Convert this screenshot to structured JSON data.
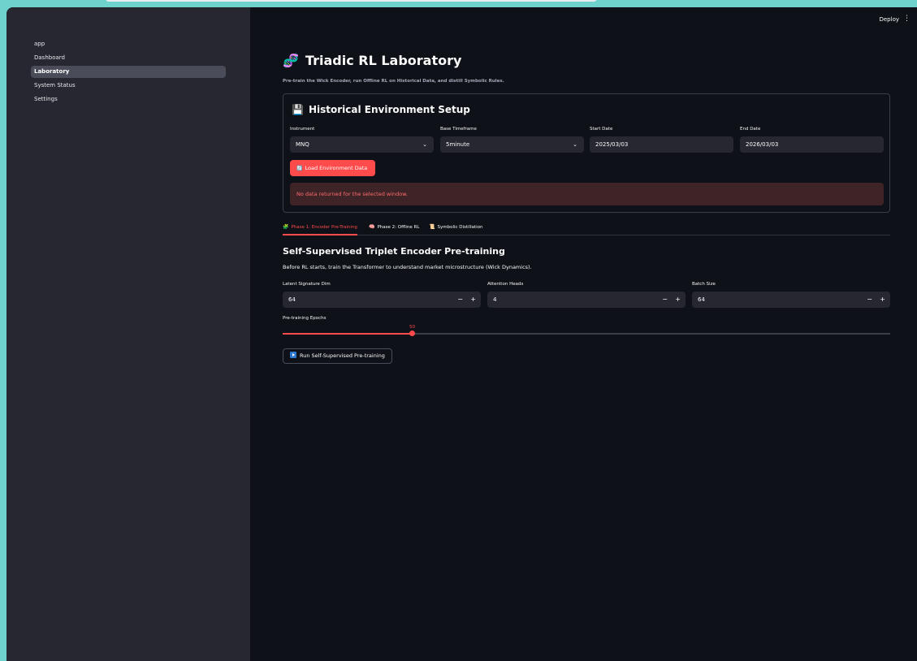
{
  "header": {
    "deploy_label": "Deploy",
    "menu_glyph": "⋮"
  },
  "sidebar": {
    "items": [
      {
        "label": "app"
      },
      {
        "label": "Dashboard"
      },
      {
        "label": "Laboratory"
      },
      {
        "label": "System Status"
      },
      {
        "label": "Settings"
      }
    ]
  },
  "page": {
    "title": "Triadic RL Laboratory",
    "title_icon": "dna-icon",
    "subtitle": "Pre-train the Wick Encoder, run Offline RL on Historical Data, and distill Symbolic Rules."
  },
  "setup": {
    "title": "Historical Environment Setup",
    "icon": "floppy-disk-icon",
    "instrument_label": "Instrument",
    "instrument_value": "MNQ",
    "timeframe_label": "Base Timeframe",
    "timeframe_value": "5minute",
    "start_label": "Start Date",
    "start_value": "2025/03/03",
    "end_label": "End Date",
    "end_value": "2026/03/03",
    "load_button": "Load Environment Data",
    "error_message": "No data returned for the selected window."
  },
  "tabs": [
    {
      "label": "Phase 1: Encoder Pre-Training",
      "icon": "puzzle-icon"
    },
    {
      "label": "Phase 2: Offline RL",
      "icon": "brain-icon"
    },
    {
      "label": "Symbolic Distillation",
      "icon": "scroll-icon"
    }
  ],
  "pretrain": {
    "title": "Self-Supervised Triplet Encoder Pre-training",
    "description": "Before RL starts, train the Transformer to understand market microstructure (Wick Dynamics).",
    "latent_label": "Latent Signature Dim",
    "latent_value": "64",
    "heads_label": "Attention Heads",
    "heads_value": "4",
    "batch_label": "Batch Size",
    "batch_value": "64",
    "minus": "−",
    "plus": "+",
    "epochs_label": "Pre-training Epochs",
    "epochs_value": "50",
    "epochs_fraction": 0.213,
    "run_button": "Run Self-Supervised Pre-training"
  },
  "colors": {
    "accent": "#ff4b4b",
    "sidebar": "#262730",
    "background": "#0e1117"
  }
}
